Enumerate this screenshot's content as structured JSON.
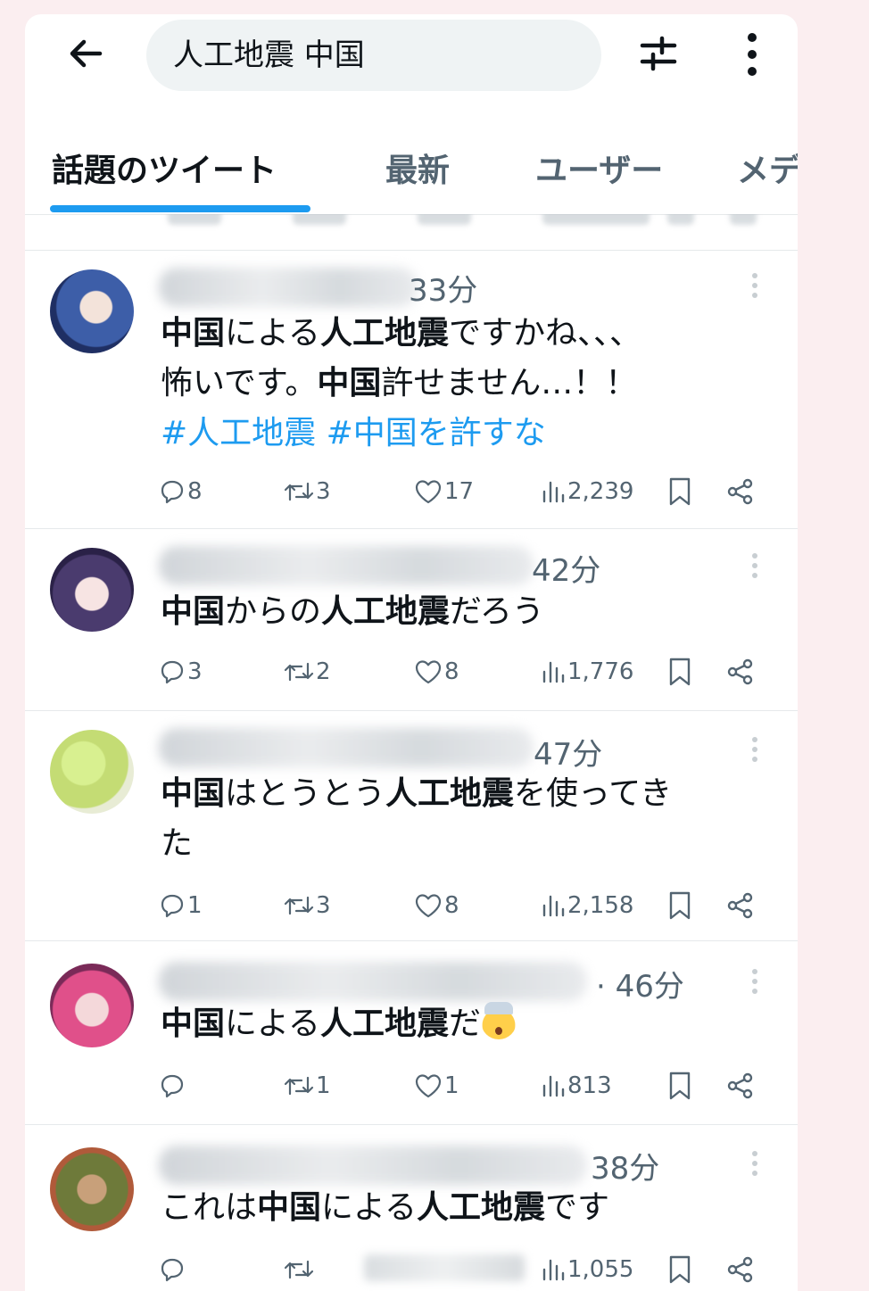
{
  "search": {
    "query": "人工地震 中国"
  },
  "tabs": [
    {
      "label": "話題のツイート",
      "active": true
    },
    {
      "label": "最新",
      "active": false
    },
    {
      "label": "ユーザー",
      "active": false
    },
    {
      "label": "メデ",
      "active": false
    }
  ],
  "colors": {
    "accent": "#1d9bf0",
    "text": "#0f1419",
    "muted": "#536471"
  },
  "tweets": [
    {
      "time": "33分",
      "body_lines": [
        [
          {
            "t": "中国",
            "b": true
          },
          {
            "t": "による",
            "b": false
          },
          {
            "t": "人工地震",
            "b": true
          },
          {
            "t": "ですかね、、、",
            "b": false
          }
        ],
        [
          {
            "t": "怖いです。",
            "b": false
          },
          {
            "t": "中国",
            "b": true
          },
          {
            "t": "許せません…！！",
            "b": false
          }
        ]
      ],
      "hashtags": "#人工地震 #中国を許すな",
      "replies": "8",
      "retweets": "3",
      "likes": "17",
      "views": "2,239"
    },
    {
      "time": "42分",
      "body_lines": [
        [
          {
            "t": "中国",
            "b": true
          },
          {
            "t": "からの",
            "b": false
          },
          {
            "t": "人工地震",
            "b": true
          },
          {
            "t": "だろう",
            "b": false
          }
        ]
      ],
      "replies": "3",
      "retweets": "2",
      "likes": "8",
      "views": "1,776"
    },
    {
      "time": "47分",
      "body_lines": [
        [
          {
            "t": "中国",
            "b": true
          },
          {
            "t": "はとうとう",
            "b": false
          },
          {
            "t": "人工地震",
            "b": true
          },
          {
            "t": "を使ってき",
            "b": false
          }
        ],
        [
          {
            "t": "た",
            "b": false
          }
        ]
      ],
      "replies": "1",
      "retweets": "3",
      "likes": "8",
      "views": "2,158"
    },
    {
      "time": "· 46分",
      "body_lines": [
        [
          {
            "t": "中国",
            "b": true
          },
          {
            "t": "による",
            "b": false
          },
          {
            "t": "人工地震",
            "b": true
          },
          {
            "t": "だ",
            "b": false
          }
        ]
      ],
      "emoji": "exploding-head",
      "replies": "",
      "retweets": "1",
      "likes": "1",
      "views": "813"
    },
    {
      "time": "38分",
      "body_lines": [
        [
          {
            "t": "これは",
            "b": false
          },
          {
            "t": "中国",
            "b": true
          },
          {
            "t": "による",
            "b": false
          },
          {
            "t": "人工地震",
            "b": true
          },
          {
            "t": "です",
            "b": false
          }
        ]
      ],
      "replies": "",
      "retweets": "",
      "likes": "",
      "views": "1,055"
    }
  ]
}
